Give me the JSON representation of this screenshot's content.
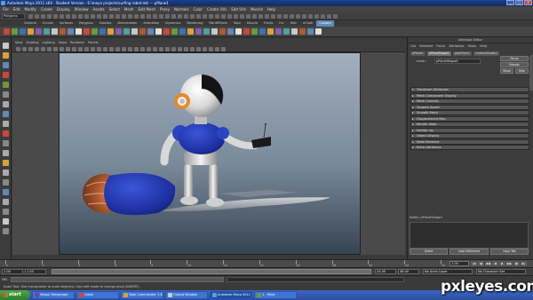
{
  "window": {
    "title": "Autodesk Maya 2011 x64 - Student Version - E:\\maya projects\\surfing robot.mb --- pPlane1",
    "controls": [
      "_",
      "□",
      "×"
    ]
  },
  "menubar": [
    "File",
    "Edit",
    "Modify",
    "Create",
    "Display",
    "Window",
    "Assets",
    "Select",
    "Mesh",
    "Edit Mesh",
    "Proxy",
    "Normals",
    "Color",
    "Create UVs",
    "Edit UVs",
    "Muscle",
    "Help"
  ],
  "statusline": {
    "mode": "Polygons"
  },
  "shelf": {
    "tabs": [
      "General",
      "Curves",
      "Surfaces",
      "Polygons",
      "Subdivs",
      "Deformation",
      "Animation",
      "Dynamics",
      "Rendering",
      "PaintEffects",
      "Toon",
      "Muscle",
      "Fluids",
      "Fur",
      "Hair",
      "nCloth",
      "Custom"
    ],
    "active_tab": "Custom"
  },
  "panel": {
    "menu": [
      "View",
      "Shading",
      "Lighting",
      "Show",
      "Renderer",
      "Panels"
    ]
  },
  "attribute_editor": {
    "title": "Attribute Editor",
    "menu": [
      "List",
      "Selected",
      "Focus",
      "Attributes",
      "Show",
      "Help"
    ],
    "tabs": [
      "pPlane1",
      "pPlaneShape1",
      "polyPlane1",
      "surfaceShader1"
    ],
    "active_tab": "pPlaneShape1",
    "shape_label": "mesh:",
    "shape_value": "pPlaneShape1",
    "focus_btn": "Focus",
    "presets_btn": "Presets",
    "show_btn": "Show",
    "hide_btn": "Hide",
    "sections": [
      "Transform Attributes",
      "Mesh Component Display",
      "Mesh Controls",
      "Tangent Space",
      "Smooth Mesh",
      "Displacement Map",
      "Render Stats",
      "mental ray",
      "Object Display",
      "Node Behavior",
      "Extra Attributes"
    ],
    "notes_label": "Notes: pPlaneShape1",
    "footer": [
      "Select",
      "Load Attributes",
      "Copy Tab"
    ]
  },
  "timeslider": {
    "ticks": [
      "1",
      "2",
      "4",
      "6",
      "8",
      "10",
      "12",
      "14",
      "16",
      "18",
      "20",
      "22",
      "24"
    ],
    "current_frame": "1.00",
    "controls": [
      "|◀",
      "◀|",
      "◀◀",
      "◀",
      "▶",
      "▶▶",
      "|▶",
      "▶|"
    ]
  },
  "rangeslider": {
    "start": "1.00",
    "inner_start": "1.00",
    "inner_end": "24.00",
    "end": "48.00",
    "anim_layer": "No Anim Layer",
    "char_set": "No Character Set"
  },
  "mel": {
    "label": "MEL"
  },
  "helpline": {
    "text": "Scale Tool: Use manipulator to scale object(s). Use edit mode to change pivot (INSERT)."
  },
  "taskbar": {
    "start": "start",
    "tasks": [
      {
        "label": "Yahoo! Messenger",
        "active": false
      },
      {
        "label": "Gmail",
        "active": false
      },
      {
        "label": "Total Commander 7.50a",
        "active": false
      },
      {
        "label": "Output Window",
        "active": false
      },
      {
        "label": "Autodesk Maya 2011 Stud...",
        "active": true
      },
      {
        "label": "1 - Paint",
        "active": false
      }
    ]
  },
  "watermark": {
    "text": "pxleyes.com"
  },
  "colors": {
    "titlebar": "#1c3f86",
    "viewport_top": "#a2afbe",
    "viewport_bottom": "#364452",
    "robot_body_blue": "#1d2fa0",
    "thruster_orange": "#b05a2e",
    "accent_orange": "#e28b2c"
  }
}
